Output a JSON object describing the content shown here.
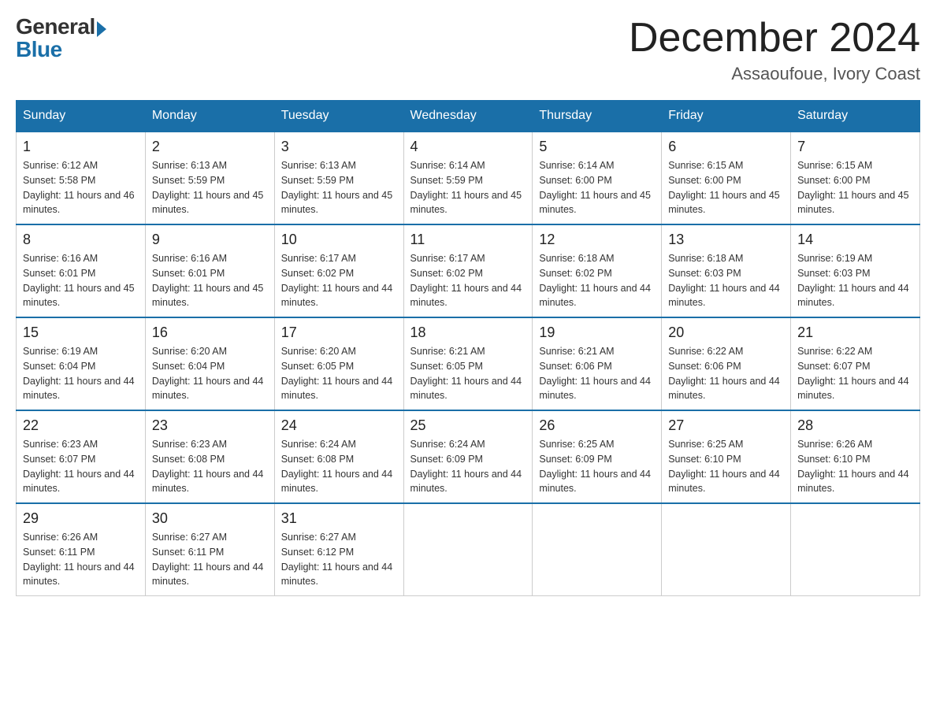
{
  "logo": {
    "general": "General",
    "blue": "Blue"
  },
  "title": {
    "month_year": "December 2024",
    "location": "Assaoufoue, Ivory Coast"
  },
  "headers": [
    "Sunday",
    "Monday",
    "Tuesday",
    "Wednesday",
    "Thursday",
    "Friday",
    "Saturday"
  ],
  "weeks": [
    [
      {
        "day": "1",
        "sunrise": "6:12 AM",
        "sunset": "5:58 PM",
        "daylight": "11 hours and 46 minutes."
      },
      {
        "day": "2",
        "sunrise": "6:13 AM",
        "sunset": "5:59 PM",
        "daylight": "11 hours and 45 minutes."
      },
      {
        "day": "3",
        "sunrise": "6:13 AM",
        "sunset": "5:59 PM",
        "daylight": "11 hours and 45 minutes."
      },
      {
        "day": "4",
        "sunrise": "6:14 AM",
        "sunset": "5:59 PM",
        "daylight": "11 hours and 45 minutes."
      },
      {
        "day": "5",
        "sunrise": "6:14 AM",
        "sunset": "6:00 PM",
        "daylight": "11 hours and 45 minutes."
      },
      {
        "day": "6",
        "sunrise": "6:15 AM",
        "sunset": "6:00 PM",
        "daylight": "11 hours and 45 minutes."
      },
      {
        "day": "7",
        "sunrise": "6:15 AM",
        "sunset": "6:00 PM",
        "daylight": "11 hours and 45 minutes."
      }
    ],
    [
      {
        "day": "8",
        "sunrise": "6:16 AM",
        "sunset": "6:01 PM",
        "daylight": "11 hours and 45 minutes."
      },
      {
        "day": "9",
        "sunrise": "6:16 AM",
        "sunset": "6:01 PM",
        "daylight": "11 hours and 45 minutes."
      },
      {
        "day": "10",
        "sunrise": "6:17 AM",
        "sunset": "6:02 PM",
        "daylight": "11 hours and 44 minutes."
      },
      {
        "day": "11",
        "sunrise": "6:17 AM",
        "sunset": "6:02 PM",
        "daylight": "11 hours and 44 minutes."
      },
      {
        "day": "12",
        "sunrise": "6:18 AM",
        "sunset": "6:02 PM",
        "daylight": "11 hours and 44 minutes."
      },
      {
        "day": "13",
        "sunrise": "6:18 AM",
        "sunset": "6:03 PM",
        "daylight": "11 hours and 44 minutes."
      },
      {
        "day": "14",
        "sunrise": "6:19 AM",
        "sunset": "6:03 PM",
        "daylight": "11 hours and 44 minutes."
      }
    ],
    [
      {
        "day": "15",
        "sunrise": "6:19 AM",
        "sunset": "6:04 PM",
        "daylight": "11 hours and 44 minutes."
      },
      {
        "day": "16",
        "sunrise": "6:20 AM",
        "sunset": "6:04 PM",
        "daylight": "11 hours and 44 minutes."
      },
      {
        "day": "17",
        "sunrise": "6:20 AM",
        "sunset": "6:05 PM",
        "daylight": "11 hours and 44 minutes."
      },
      {
        "day": "18",
        "sunrise": "6:21 AM",
        "sunset": "6:05 PM",
        "daylight": "11 hours and 44 minutes."
      },
      {
        "day": "19",
        "sunrise": "6:21 AM",
        "sunset": "6:06 PM",
        "daylight": "11 hours and 44 minutes."
      },
      {
        "day": "20",
        "sunrise": "6:22 AM",
        "sunset": "6:06 PM",
        "daylight": "11 hours and 44 minutes."
      },
      {
        "day": "21",
        "sunrise": "6:22 AM",
        "sunset": "6:07 PM",
        "daylight": "11 hours and 44 minutes."
      }
    ],
    [
      {
        "day": "22",
        "sunrise": "6:23 AM",
        "sunset": "6:07 PM",
        "daylight": "11 hours and 44 minutes."
      },
      {
        "day": "23",
        "sunrise": "6:23 AM",
        "sunset": "6:08 PM",
        "daylight": "11 hours and 44 minutes."
      },
      {
        "day": "24",
        "sunrise": "6:24 AM",
        "sunset": "6:08 PM",
        "daylight": "11 hours and 44 minutes."
      },
      {
        "day": "25",
        "sunrise": "6:24 AM",
        "sunset": "6:09 PM",
        "daylight": "11 hours and 44 minutes."
      },
      {
        "day": "26",
        "sunrise": "6:25 AM",
        "sunset": "6:09 PM",
        "daylight": "11 hours and 44 minutes."
      },
      {
        "day": "27",
        "sunrise": "6:25 AM",
        "sunset": "6:10 PM",
        "daylight": "11 hours and 44 minutes."
      },
      {
        "day": "28",
        "sunrise": "6:26 AM",
        "sunset": "6:10 PM",
        "daylight": "11 hours and 44 minutes."
      }
    ],
    [
      {
        "day": "29",
        "sunrise": "6:26 AM",
        "sunset": "6:11 PM",
        "daylight": "11 hours and 44 minutes."
      },
      {
        "day": "30",
        "sunrise": "6:27 AM",
        "sunset": "6:11 PM",
        "daylight": "11 hours and 44 minutes."
      },
      {
        "day": "31",
        "sunrise": "6:27 AM",
        "sunset": "6:12 PM",
        "daylight": "11 hours and 44 minutes."
      },
      null,
      null,
      null,
      null
    ]
  ]
}
